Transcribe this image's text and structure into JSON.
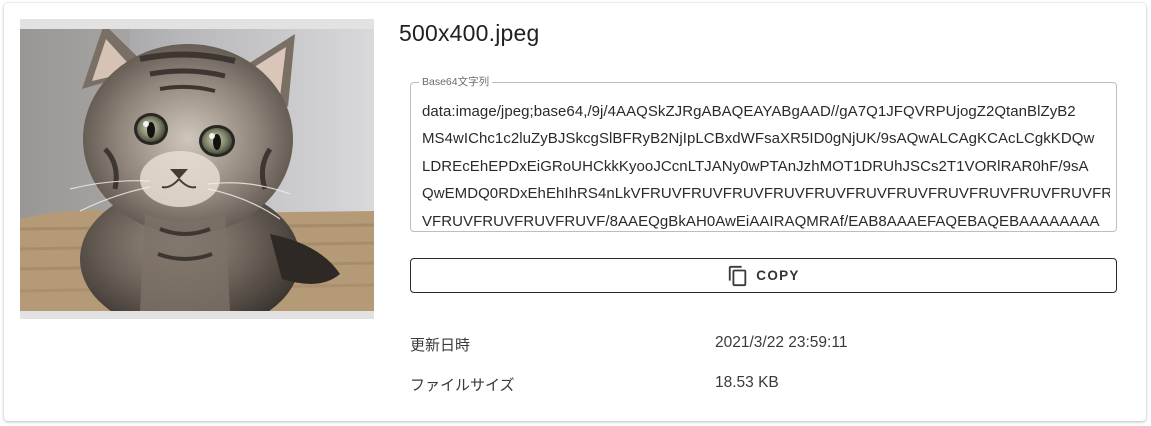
{
  "file": {
    "name": "500x400.jpeg",
    "thumbnail_alt": "kitten photo"
  },
  "base64": {
    "label": "Base64文字列",
    "value": "data:image/jpeg;base64,/9j/4AAQSkZJRgABAQEAYABgAAD//gA7Q1JFQVRPUjogZ2QtanBlZyB2\nMS4wIChc1c2luZyBJSkcgSlBFRyB2NjIpLCBxdWFsaXR5ID0gNjUK/9sAQwALCAgKCAcLCgkKDQw\nLDREcEhEPDxEiGRoUHCkkKyooJCcnLTJANy0wPTAnJzhMOT1DRUhJSCs2T1VORlRAR0hF/9sA\nQwEMDQ0RDxEhEhIhRS4nLkVFRUVFRUVFRUVFRUVFRUVFRUVFRUVFRUVFRUVFRUVFRUVFRUVFRU\nVFRUVFRUVFRUVFRUVF/8AAEQgBkAH0AwEiAAIRAQMRAf/EAB8AAAEFAQEBAQEBAAAAAAAA"
  },
  "copy_button": {
    "label": "COPY",
    "icon": "copy-icon"
  },
  "details": {
    "updated_label": "更新日時",
    "updated_value": "2021/3/22 23:59:11",
    "size_label": "ファイルサイズ",
    "size_value": "18.53 KB"
  },
  "colors": {
    "text": "#212121",
    "border": "#bdbdbd",
    "button_border": "#2b2b2b"
  }
}
